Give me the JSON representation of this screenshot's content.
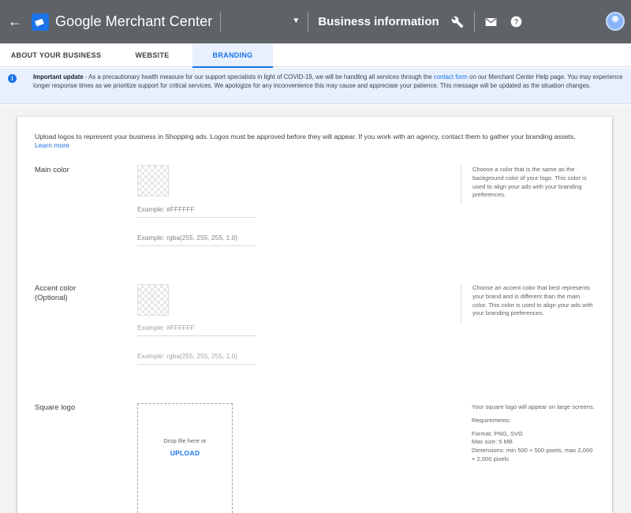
{
  "appbar": {
    "brand": "Google Merchant Center",
    "page_title": "Business information",
    "icons": [
      "arrow-back-icon",
      "merchant-logo-icon",
      "dropdown-caret-icon",
      "wrench-icon",
      "mail-icon",
      "help-icon",
      "avatar-icon"
    ]
  },
  "tabs": [
    {
      "label": "ABOUT YOUR BUSINESS",
      "active": false
    },
    {
      "label": "WEBSITE",
      "active": false
    },
    {
      "label": "BRANDING",
      "active": true
    }
  ],
  "notice": {
    "title": "Important update",
    "text_before_link": " - As a precautionary health measure for our support specialists in light of COVID-19, we will be handling all services through the ",
    "link": "contact form",
    "text_after_link": " on our Merchant Center Help page. You may experience longer response times as we prioritize support for critical services. We apologize for any inconvenience this may cause and appreciate your patience. This message will be updated as the situation changes."
  },
  "intro": {
    "text": "Upload logos to represent your business in Shopping ads. Logos must be approved before they will appear. If you work with an agency, contact them to gather your branding assets.",
    "learn_more": "Learn more"
  },
  "main_color": {
    "label": "Main color",
    "hex_placeholder": "Example: #FFFFFF",
    "rgba_placeholder": "Example: rgba(255, 255, 255, 1.0)",
    "help": "Choose a color that is the same as the background color of your logo. This color is used to align your ads with your branding preferences."
  },
  "accent_color": {
    "label": "Accent color",
    "label_optional": "(Optional)",
    "hex_placeholder": "Example: #FFFFFF",
    "rgba_placeholder": "Example: rgba(255, 255, 255, 1.0)",
    "help": "Choose an accent color that best represents your brand and is different than the main color. This color is used to align your ads with your branding preferences."
  },
  "square_logo": {
    "label": "Square logo",
    "drop_text": "Drop file here or",
    "upload_label": "UPLOAD",
    "help_intro": "Your square logo will appear on large screens.",
    "requirements_title": "Requirements:",
    "req_format": "Format: PNG, SVG",
    "req_size": "Max size: 5 MB",
    "req_dimensions": "Dimensions: min 500 × 500 pixels, max 2,000 × 2,000 pixels"
  },
  "colors": {
    "appbar": "#5f6368",
    "accent": "#1a73e8",
    "notice_bg": "#e8f0fe",
    "page_bg": "#f1f3f4"
  }
}
